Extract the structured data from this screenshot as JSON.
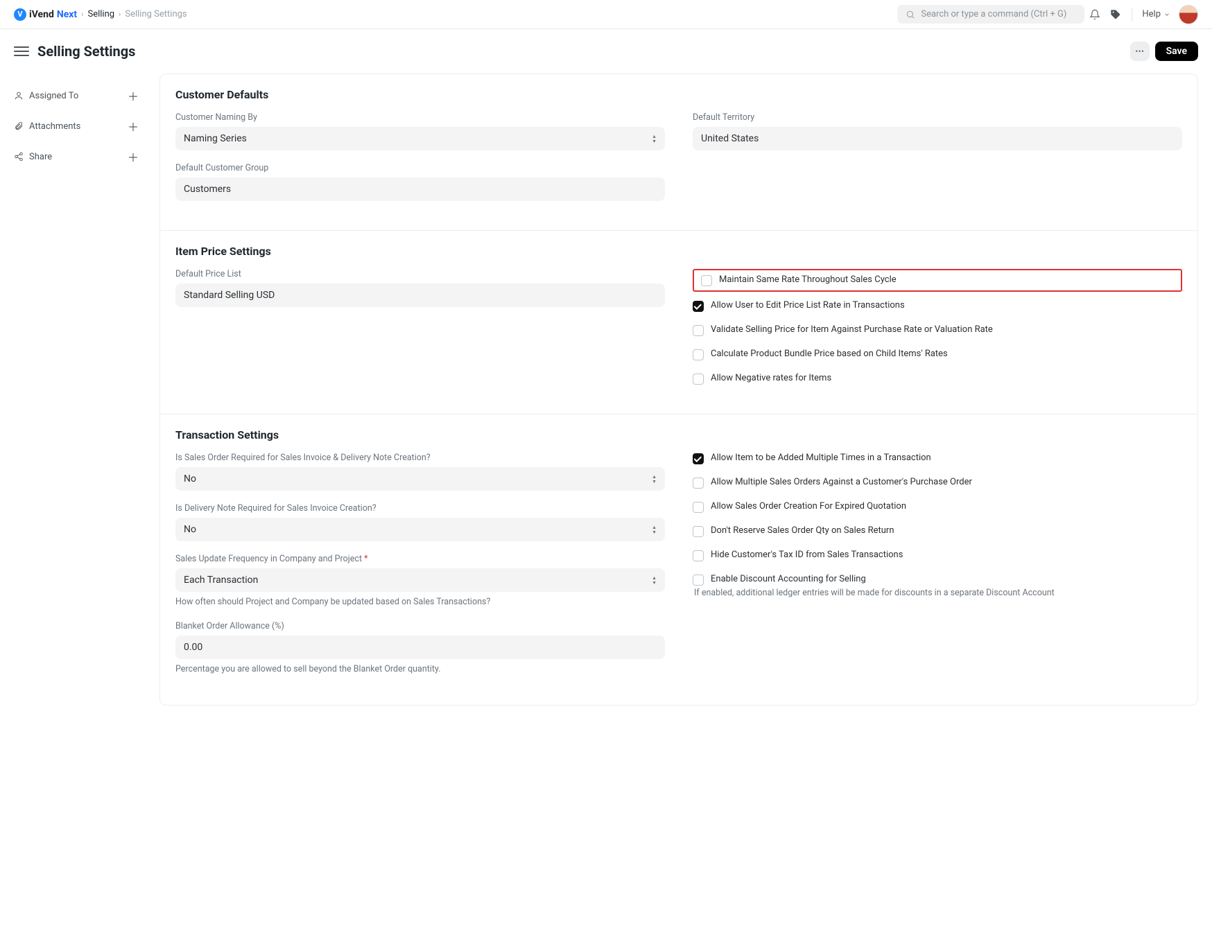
{
  "brand": {
    "iVend": "iVend",
    "Next": "Next"
  },
  "breadcrumbs": {
    "selling": "Selling",
    "current": "Selling Settings"
  },
  "search": {
    "placeholder": "Search or type a command (Ctrl + G)"
  },
  "help": {
    "label": "Help"
  },
  "page": {
    "title": "Selling Settings",
    "save": "Save"
  },
  "sidebar": {
    "assigned": "Assigned To",
    "attachments": "Attachments",
    "share": "Share"
  },
  "customer_defaults": {
    "heading": "Customer Defaults",
    "naming_by_label": "Customer Naming By",
    "naming_by_value": "Naming Series",
    "default_customer_group_label": "Default Customer Group",
    "default_customer_group_value": "Customers",
    "default_territory_label": "Default Territory",
    "default_territory_value": "United States"
  },
  "item_price": {
    "heading": "Item Price Settings",
    "default_price_list_label": "Default Price List",
    "default_price_list_value": "Standard Selling USD",
    "cb_maintain": "Maintain Same Rate Throughout Sales Cycle",
    "cb_allow_edit": "Allow User to Edit Price List Rate in Transactions",
    "cb_validate": "Validate Selling Price for Item Against Purchase Rate or Valuation Rate",
    "cb_bundle": "Calculate Product Bundle Price based on Child Items' Rates",
    "cb_negative": "Allow Negative rates for Items"
  },
  "transaction": {
    "heading": "Transaction Settings",
    "so_required_label": "Is Sales Order Required for Sales Invoice & Delivery Note Creation?",
    "so_required_value": "No",
    "dn_required_label": "Is Delivery Note Required for Sales Invoice Creation?",
    "dn_required_value": "No",
    "freq_label": "Sales Update Frequency in Company and Project",
    "freq_value": "Each Transaction",
    "freq_help": "How often should Project and Company be updated based on Sales Transactions?",
    "blanket_label": "Blanket Order Allowance (%)",
    "blanket_value": "0.00",
    "blanket_help": "Percentage you are allowed to sell beyond the Blanket Order quantity.",
    "cb_multi_add": "Allow Item to be Added Multiple Times in a Transaction",
    "cb_multi_so": "Allow Multiple Sales Orders Against a Customer's Purchase Order",
    "cb_expired_quote": "Allow Sales Order Creation For Expired Quotation",
    "cb_dont_reserve": "Don't Reserve Sales Order Qty on Sales Return",
    "cb_hide_tax": "Hide Customer's Tax ID from Sales Transactions",
    "cb_discount_acct": "Enable Discount Accounting for Selling",
    "cb_discount_help": "If enabled, additional ledger entries will be made for discounts in a separate Discount Account"
  }
}
